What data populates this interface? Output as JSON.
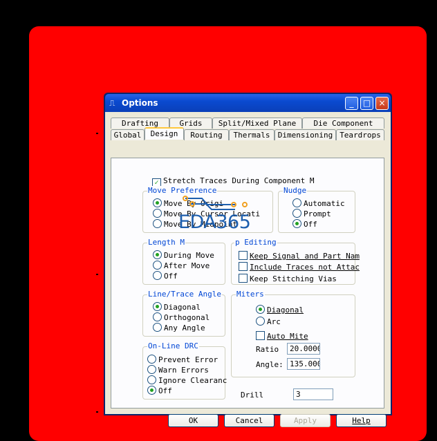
{
  "window": {
    "title": "Options",
    "minimize": "_",
    "maximize": "□",
    "close": "×"
  },
  "tabs": {
    "row1": [
      "Drafting",
      "Grids",
      "Split/Mixed Plane",
      "Die Component"
    ],
    "row2": [
      "Global",
      "Design",
      "Routing",
      "Thermals",
      "Dimensioning",
      "Teardrops"
    ],
    "active": "Design"
  },
  "stretch_traces": {
    "label": "Stretch Traces During Component M",
    "checked": true
  },
  "move_preference": {
    "label": "Move Preference",
    "options": [
      "Move By Origi",
      "Move By Cursor Locati",
      "Move By Midpoint"
    ],
    "selected": "Move By Origi"
  },
  "nudge": {
    "label": "Nudge",
    "options": [
      "Automatic",
      "Prompt",
      "Off"
    ],
    "selected": "Off"
  },
  "length_minimization": {
    "label": "Length M",
    "options": [
      "During Move",
      "After Move",
      "Off"
    ],
    "selected": "During Move"
  },
  "group_editing": {
    "label": "p Editing",
    "options": [
      "Keep Signal and Part Nam",
      "Include Traces not Attac",
      "Keep Stitching Vias"
    ]
  },
  "line_trace_angle": {
    "label": "Line/Trace Angle",
    "options": [
      "Diagonal",
      "Orthogonal",
      "Any Angle"
    ],
    "selected": "Diagonal"
  },
  "miters": {
    "label": "Miters",
    "options": [
      "Diagonal",
      "Arc"
    ],
    "selected": "Diagonal",
    "auto_miter": "Auto Mite",
    "ratio_label": "Ratio",
    "ratio_value": "20.0000",
    "angle_label": "Angle:",
    "angle_value": "135.0000"
  },
  "online_drc": {
    "label": "On-Line DRC",
    "options": [
      "Prevent Error",
      "Warn Errors",
      "Ignore Clearanc",
      "Off"
    ],
    "selected": "Off"
  },
  "drill": {
    "label": "Drill",
    "value": "3"
  },
  "buttons": {
    "ok": "OK",
    "cancel": "Cancel",
    "apply": "Apply",
    "help": "Help"
  },
  "watermark": "EDA365",
  "colors": {
    "window_frame": "#0a246a",
    "titlebar": "#0a4ad0",
    "background": "#ff0000",
    "group_label": "#0046d5"
  }
}
